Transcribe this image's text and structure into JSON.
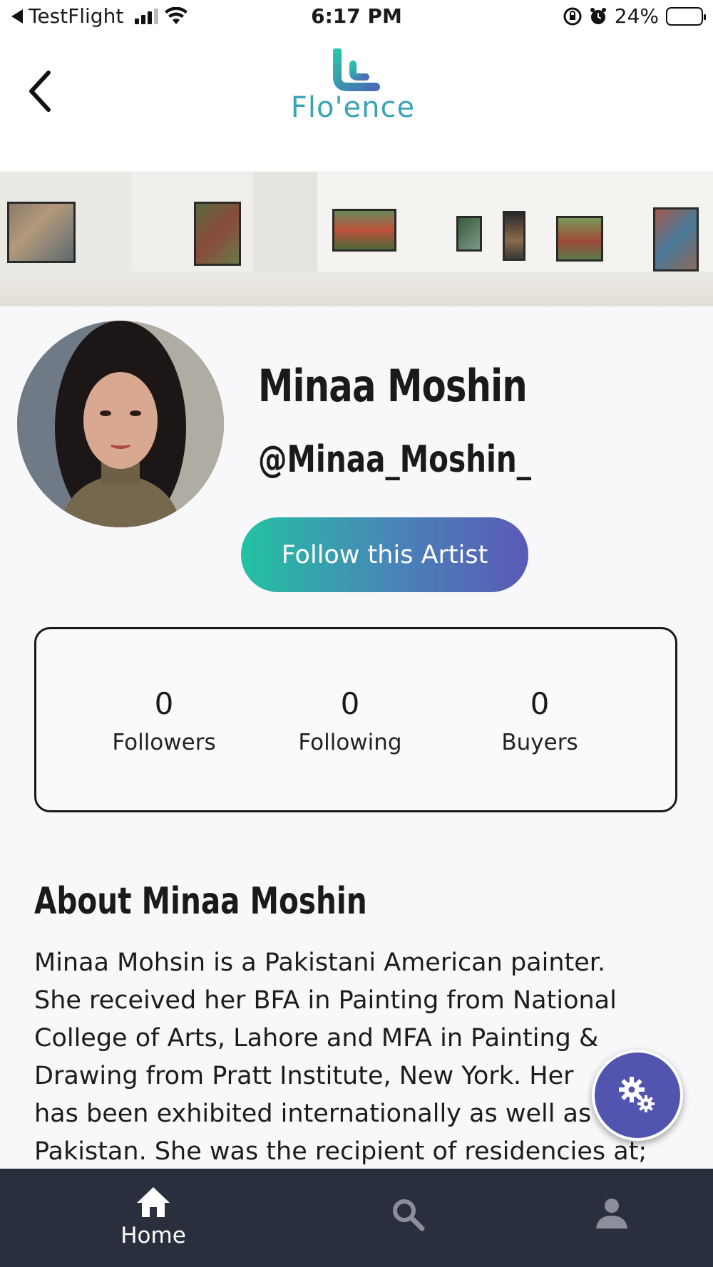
{
  "status_bar": {
    "carrier": "TestFlight",
    "time": "6:17 PM",
    "battery": "24%",
    "battery_level": 0.24
  },
  "header": {
    "logo_text": "Flo'ence"
  },
  "profile": {
    "name": "Minaa Moshin",
    "handle": "@Minaa_Moshin_",
    "follow_label": "Follow this Artist"
  },
  "stats": [
    {
      "value": "0",
      "label": "Followers"
    },
    {
      "value": "0",
      "label": "Following"
    },
    {
      "value": "0",
      "label": "Buyers"
    }
  ],
  "about": {
    "title": "About Minaa Moshin",
    "lines": [
      "Minaa Mohsin is a Pakistani American painter.",
      "She received her BFA in Painting from National",
      "College of Arts, Lahore and MFA in Painting &",
      "Drawing from Pratt Institute, New York. Her",
      "has been exhibited internationally as well as",
      "Pakistan. She was the recipient of residencies at;"
    ]
  },
  "nav": {
    "home_label": "Home"
  },
  "icons": {
    "back": "chevron-left-icon",
    "fab": "gears-icon",
    "home": "home-icon",
    "search": "search-icon",
    "profile": "person-icon"
  },
  "colors": {
    "accent_start": "#23c2a2",
    "accent_end": "#5a5ab6",
    "fab": "#5155b0",
    "nav_bg": "#2a2f3e"
  }
}
